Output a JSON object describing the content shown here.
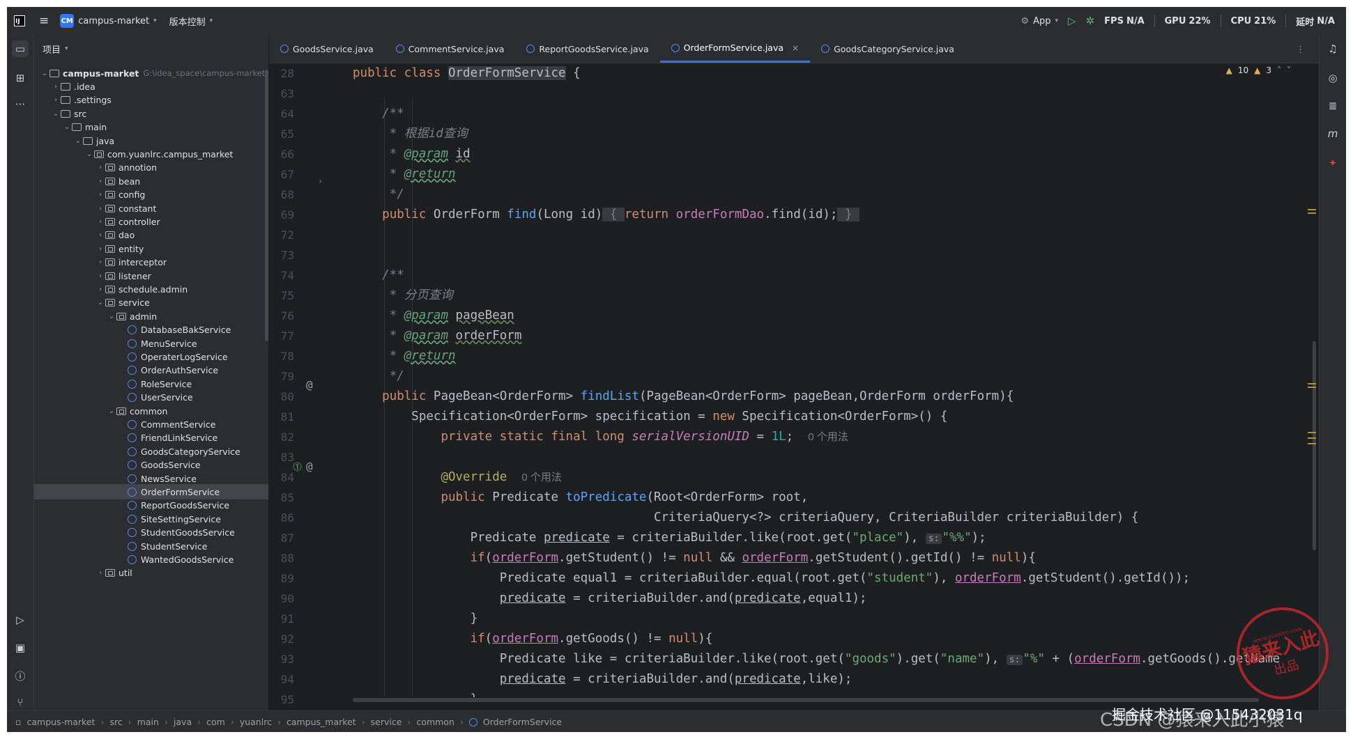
{
  "titlebar": {
    "project_badge": "CM",
    "project_name": "campus-market",
    "vcs_label": "版本控制",
    "run_config": "App",
    "fps_label": "FPS",
    "fps_value": "N/A",
    "gpu_label": "GPU",
    "gpu_value": "22%",
    "cpu_label": "CPU",
    "cpu_value": "21%",
    "latency_label": "延时",
    "latency_value": "N/A"
  },
  "project_panel": {
    "title": "项目",
    "tree": [
      {
        "label": "campus-market",
        "hint": "G:\\idea_space\\campus-market",
        "type": "root",
        "depth": 0,
        "expanded": true
      },
      {
        "label": ".idea",
        "type": "folder",
        "depth": 1,
        "expanded": false
      },
      {
        "label": ".settings",
        "type": "folder",
        "depth": 1,
        "expanded": false
      },
      {
        "label": "src",
        "type": "folder",
        "depth": 1,
        "expanded": true
      },
      {
        "label": "main",
        "type": "folder",
        "depth": 2,
        "expanded": true
      },
      {
        "label": "java",
        "type": "folder",
        "depth": 3,
        "expanded": true
      },
      {
        "label": "com.yuanlrc.campus_market",
        "type": "package",
        "depth": 4,
        "expanded": true
      },
      {
        "label": "annotion",
        "type": "package",
        "depth": 5,
        "expanded": false
      },
      {
        "label": "bean",
        "type": "package",
        "depth": 5,
        "expanded": false
      },
      {
        "label": "config",
        "type": "package",
        "depth": 5,
        "expanded": false
      },
      {
        "label": "constant",
        "type": "package",
        "depth": 5,
        "expanded": false
      },
      {
        "label": "controller",
        "type": "package",
        "depth": 5,
        "expanded": false
      },
      {
        "label": "dao",
        "type": "package",
        "depth": 5,
        "expanded": false
      },
      {
        "label": "entity",
        "type": "package",
        "depth": 5,
        "expanded": false
      },
      {
        "label": "interceptor",
        "type": "package",
        "depth": 5,
        "expanded": false
      },
      {
        "label": "listener",
        "type": "package",
        "depth": 5,
        "expanded": false
      },
      {
        "label": "schedule.admin",
        "type": "package",
        "depth": 5,
        "expanded": false
      },
      {
        "label": "service",
        "type": "package",
        "depth": 5,
        "expanded": true
      },
      {
        "label": "admin",
        "type": "package",
        "depth": 6,
        "expanded": true
      },
      {
        "label": "DatabaseBakService",
        "type": "class",
        "depth": 7
      },
      {
        "label": "MenuService",
        "type": "class",
        "depth": 7
      },
      {
        "label": "OperaterLogService",
        "type": "class",
        "depth": 7
      },
      {
        "label": "OrderAuthService",
        "type": "class",
        "depth": 7
      },
      {
        "label": "RoleService",
        "type": "class",
        "depth": 7
      },
      {
        "label": "UserService",
        "type": "class",
        "depth": 7
      },
      {
        "label": "common",
        "type": "package",
        "depth": 6,
        "expanded": true
      },
      {
        "label": "CommentService",
        "type": "class",
        "depth": 7
      },
      {
        "label": "FriendLinkService",
        "type": "class",
        "depth": 7
      },
      {
        "label": "GoodsCategoryService",
        "type": "class",
        "depth": 7
      },
      {
        "label": "GoodsService",
        "type": "class",
        "depth": 7
      },
      {
        "label": "NewsService",
        "type": "class",
        "depth": 7
      },
      {
        "label": "OrderFormService",
        "type": "class",
        "depth": 7,
        "selected": true
      },
      {
        "label": "ReportGoodsService",
        "type": "class",
        "depth": 7
      },
      {
        "label": "SiteSettingService",
        "type": "class",
        "depth": 7
      },
      {
        "label": "StudentGoodsService",
        "type": "class",
        "depth": 7
      },
      {
        "label": "StudentService",
        "type": "class",
        "depth": 7
      },
      {
        "label": "WantedGoodsService",
        "type": "class",
        "depth": 7
      },
      {
        "label": "util",
        "type": "package",
        "depth": 5,
        "expanded": false
      }
    ]
  },
  "tabs": [
    {
      "label": "GoodsService.java",
      "active": false
    },
    {
      "label": "CommentService.java",
      "active": false
    },
    {
      "label": "ReportGoodsService.java",
      "active": false
    },
    {
      "label": "OrderFormService.java",
      "active": true
    },
    {
      "label": "GoodsCategoryService.java",
      "active": false
    }
  ],
  "inspections": {
    "warnings": "10",
    "weak_warnings": "3"
  },
  "editor": {
    "line_numbers": [
      "28",
      "63",
      "64",
      "65",
      "66",
      "67",
      "68",
      "69",
      "72",
      "73",
      "74",
      "75",
      "76",
      "77",
      "78",
      "79",
      "80",
      "81",
      "82",
      "83",
      "84",
      "85",
      "86",
      "87",
      "88",
      "89",
      "90",
      "91",
      "92",
      "93",
      "94",
      "95"
    ],
    "sticky_line": "public class OrderFormService {",
    "comment_find": "根据id查询",
    "comment_findlist": "分页查询",
    "usage_hint": "0 个用法",
    "param_s": "s:"
  },
  "statusbar": {
    "crumbs": [
      "campus-market",
      "src",
      "main",
      "java",
      "com",
      "yuanlrc",
      "campus_market",
      "service",
      "common",
      "OrderFormService"
    ]
  },
  "watermark": {
    "stamp_url": "www.yuanlrc.com",
    "stamp_main": "猿来入此",
    "stamp_sub": "出品",
    "overlay": "掘金技术社区 @115432031q",
    "csdn": "CSDN @猿来入此小猿"
  }
}
